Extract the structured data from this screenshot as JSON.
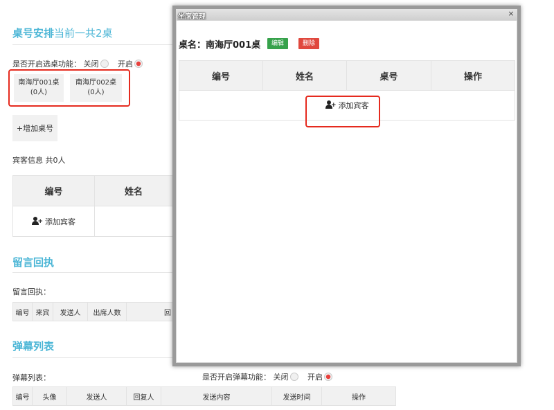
{
  "section_seating": {
    "title": "桌号安排",
    "subtitle": "当前一共2桌",
    "toggle_label": "是否开启选桌功能：",
    "option_off": "关闭",
    "option_on": "开启",
    "selected": "开启",
    "tables": [
      {
        "name": "南海厅001桌",
        "count": "(0人)"
      },
      {
        "name": "南海厅002桌",
        "count": "(0人)"
      }
    ],
    "add_table_label": "+增加桌号",
    "guest_info_label": "宾客信息 共0人",
    "guest_table": {
      "headers": [
        "编号",
        "姓名"
      ],
      "add_guest_label": "添加宾客"
    }
  },
  "section_messages": {
    "title": "留言回执",
    "label": "留言回执：",
    "headers": [
      "编号",
      "来宾",
      "发送人",
      "出席人数",
      "回"
    ]
  },
  "section_barrage": {
    "title": "弹幕列表",
    "label": "弹幕列表：",
    "toggle_label": "是否开启弹幕功能：",
    "option_off": "关闭",
    "option_on": "开启",
    "selected": "开启",
    "headers": [
      "编号",
      "头像",
      "发送人",
      "回复人",
      "发送内容",
      "发送时间",
      "操作"
    ]
  },
  "modal": {
    "title": "坐席管理",
    "close_icon": "×",
    "desk_label": "桌名：南海厅001桌",
    "edit_label": "编辑",
    "delete_label": "删除",
    "headers": [
      "编号",
      "姓名",
      "桌号",
      "操作"
    ],
    "add_guest_label": "添加宾客"
  },
  "colors": {
    "accent": "#4cb6d6",
    "edit": "#36a24b",
    "delete": "#e0483e",
    "highlight": "#e52a1e"
  }
}
